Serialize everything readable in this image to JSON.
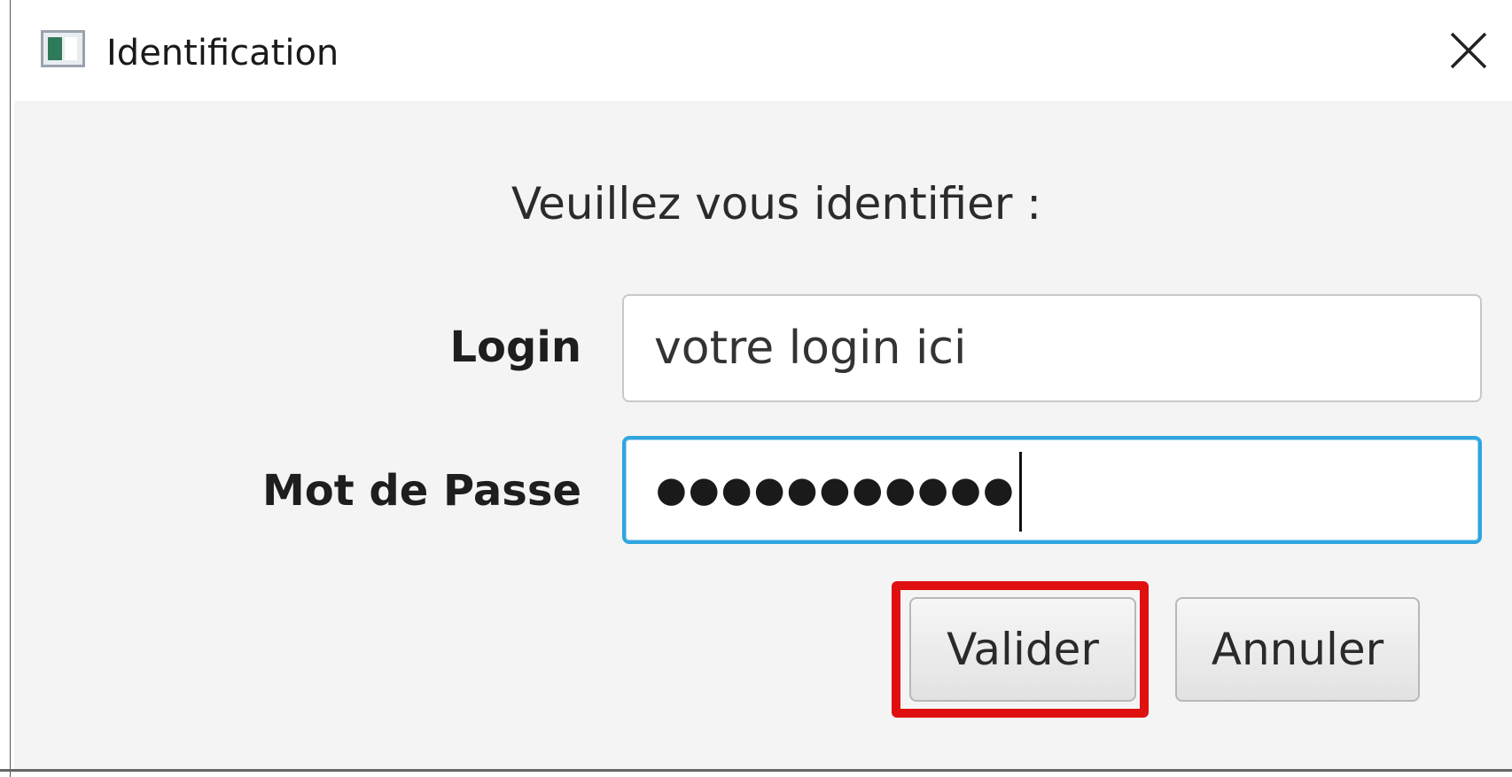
{
  "window": {
    "title": "Identification"
  },
  "icons": {
    "app": "app-window-icon",
    "close": "close-icon"
  },
  "dialog": {
    "prompt": "Veuillez vous identifier :",
    "login_label": "Login",
    "login_value": "votre login ici",
    "password_label": "Mot de Passe",
    "password_masked": "●●●●●●●●●●●",
    "validate_label": "Valider",
    "cancel_label": "Annuler"
  },
  "colors": {
    "focus_border": "#2fa6df",
    "highlight": "#e01010",
    "background": "#f4f4f4"
  }
}
